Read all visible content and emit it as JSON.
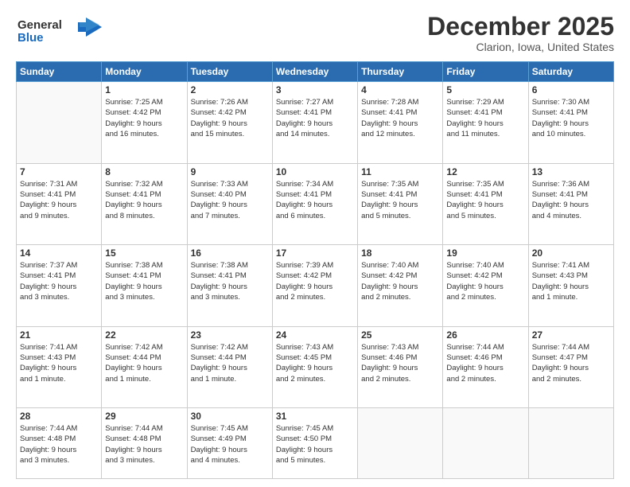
{
  "header": {
    "logo_line1": "General",
    "logo_line2": "Blue",
    "month": "December 2025",
    "location": "Clarion, Iowa, United States"
  },
  "days_of_week": [
    "Sunday",
    "Monday",
    "Tuesday",
    "Wednesday",
    "Thursday",
    "Friday",
    "Saturday"
  ],
  "weeks": [
    [
      {
        "day": "",
        "sunrise": "",
        "sunset": "",
        "daylight": ""
      },
      {
        "day": "1",
        "sunrise": "Sunrise: 7:25 AM",
        "sunset": "Sunset: 4:42 PM",
        "daylight": "Daylight: 9 hours and 16 minutes."
      },
      {
        "day": "2",
        "sunrise": "Sunrise: 7:26 AM",
        "sunset": "Sunset: 4:42 PM",
        "daylight": "Daylight: 9 hours and 15 minutes."
      },
      {
        "day": "3",
        "sunrise": "Sunrise: 7:27 AM",
        "sunset": "Sunset: 4:41 PM",
        "daylight": "Daylight: 9 hours and 14 minutes."
      },
      {
        "day": "4",
        "sunrise": "Sunrise: 7:28 AM",
        "sunset": "Sunset: 4:41 PM",
        "daylight": "Daylight: 9 hours and 12 minutes."
      },
      {
        "day": "5",
        "sunrise": "Sunrise: 7:29 AM",
        "sunset": "Sunset: 4:41 PM",
        "daylight": "Daylight: 9 hours and 11 minutes."
      },
      {
        "day": "6",
        "sunrise": "Sunrise: 7:30 AM",
        "sunset": "Sunset: 4:41 PM",
        "daylight": "Daylight: 9 hours and 10 minutes."
      }
    ],
    [
      {
        "day": "7",
        "sunrise": "Sunrise: 7:31 AM",
        "sunset": "Sunset: 4:41 PM",
        "daylight": "Daylight: 9 hours and 9 minutes."
      },
      {
        "day": "8",
        "sunrise": "Sunrise: 7:32 AM",
        "sunset": "Sunset: 4:41 PM",
        "daylight": "Daylight: 9 hours and 8 minutes."
      },
      {
        "day": "9",
        "sunrise": "Sunrise: 7:33 AM",
        "sunset": "Sunset: 4:40 PM",
        "daylight": "Daylight: 9 hours and 7 minutes."
      },
      {
        "day": "10",
        "sunrise": "Sunrise: 7:34 AM",
        "sunset": "Sunset: 4:41 PM",
        "daylight": "Daylight: 9 hours and 6 minutes."
      },
      {
        "day": "11",
        "sunrise": "Sunrise: 7:35 AM",
        "sunset": "Sunset: 4:41 PM",
        "daylight": "Daylight: 9 hours and 5 minutes."
      },
      {
        "day": "12",
        "sunrise": "Sunrise: 7:35 AM",
        "sunset": "Sunset: 4:41 PM",
        "daylight": "Daylight: 9 hours and 5 minutes."
      },
      {
        "day": "13",
        "sunrise": "Sunrise: 7:36 AM",
        "sunset": "Sunset: 4:41 PM",
        "daylight": "Daylight: 9 hours and 4 minutes."
      }
    ],
    [
      {
        "day": "14",
        "sunrise": "Sunrise: 7:37 AM",
        "sunset": "Sunset: 4:41 PM",
        "daylight": "Daylight: 9 hours and 3 minutes."
      },
      {
        "day": "15",
        "sunrise": "Sunrise: 7:38 AM",
        "sunset": "Sunset: 4:41 PM",
        "daylight": "Daylight: 9 hours and 3 minutes."
      },
      {
        "day": "16",
        "sunrise": "Sunrise: 7:38 AM",
        "sunset": "Sunset: 4:41 PM",
        "daylight": "Daylight: 9 hours and 3 minutes."
      },
      {
        "day": "17",
        "sunrise": "Sunrise: 7:39 AM",
        "sunset": "Sunset: 4:42 PM",
        "daylight": "Daylight: 9 hours and 2 minutes."
      },
      {
        "day": "18",
        "sunrise": "Sunrise: 7:40 AM",
        "sunset": "Sunset: 4:42 PM",
        "daylight": "Daylight: 9 hours and 2 minutes."
      },
      {
        "day": "19",
        "sunrise": "Sunrise: 7:40 AM",
        "sunset": "Sunset: 4:42 PM",
        "daylight": "Daylight: 9 hours and 2 minutes."
      },
      {
        "day": "20",
        "sunrise": "Sunrise: 7:41 AM",
        "sunset": "Sunset: 4:43 PM",
        "daylight": "Daylight: 9 hours and 1 minute."
      }
    ],
    [
      {
        "day": "21",
        "sunrise": "Sunrise: 7:41 AM",
        "sunset": "Sunset: 4:43 PM",
        "daylight": "Daylight: 9 hours and 1 minute."
      },
      {
        "day": "22",
        "sunrise": "Sunrise: 7:42 AM",
        "sunset": "Sunset: 4:44 PM",
        "daylight": "Daylight: 9 hours and 1 minute."
      },
      {
        "day": "23",
        "sunrise": "Sunrise: 7:42 AM",
        "sunset": "Sunset: 4:44 PM",
        "daylight": "Daylight: 9 hours and 1 minute."
      },
      {
        "day": "24",
        "sunrise": "Sunrise: 7:43 AM",
        "sunset": "Sunset: 4:45 PM",
        "daylight": "Daylight: 9 hours and 2 minutes."
      },
      {
        "day": "25",
        "sunrise": "Sunrise: 7:43 AM",
        "sunset": "Sunset: 4:46 PM",
        "daylight": "Daylight: 9 hours and 2 minutes."
      },
      {
        "day": "26",
        "sunrise": "Sunrise: 7:44 AM",
        "sunset": "Sunset: 4:46 PM",
        "daylight": "Daylight: 9 hours and 2 minutes."
      },
      {
        "day": "27",
        "sunrise": "Sunrise: 7:44 AM",
        "sunset": "Sunset: 4:47 PM",
        "daylight": "Daylight: 9 hours and 2 minutes."
      }
    ],
    [
      {
        "day": "28",
        "sunrise": "Sunrise: 7:44 AM",
        "sunset": "Sunset: 4:48 PM",
        "daylight": "Daylight: 9 hours and 3 minutes."
      },
      {
        "day": "29",
        "sunrise": "Sunrise: 7:44 AM",
        "sunset": "Sunset: 4:48 PM",
        "daylight": "Daylight: 9 hours and 3 minutes."
      },
      {
        "day": "30",
        "sunrise": "Sunrise: 7:45 AM",
        "sunset": "Sunset: 4:49 PM",
        "daylight": "Daylight: 9 hours and 4 minutes."
      },
      {
        "day": "31",
        "sunrise": "Sunrise: 7:45 AM",
        "sunset": "Sunset: 4:50 PM",
        "daylight": "Daylight: 9 hours and 5 minutes."
      },
      {
        "day": "",
        "sunrise": "",
        "sunset": "",
        "daylight": ""
      },
      {
        "day": "",
        "sunrise": "",
        "sunset": "",
        "daylight": ""
      },
      {
        "day": "",
        "sunrise": "",
        "sunset": "",
        "daylight": ""
      }
    ]
  ]
}
